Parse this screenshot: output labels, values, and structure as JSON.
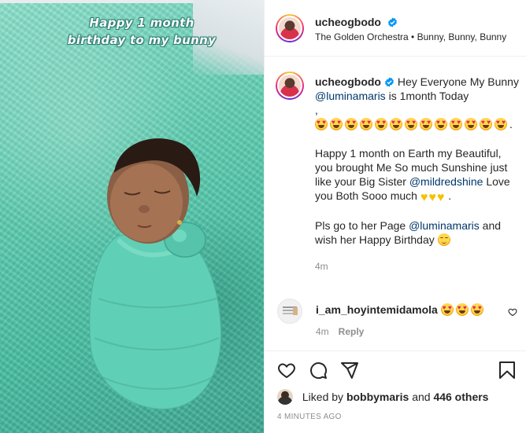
{
  "media": {
    "overlay_line1": "Happy 1 month",
    "overlay_line2": "birthday to my bunny"
  },
  "header": {
    "username": "ucheogbodo",
    "music": "The Golden Orchestra • Bunny, Bunny, Bunny"
  },
  "caption": {
    "username": "ucheogbodo",
    "line1_text": "Hey Everyone My Bunny",
    "line1_mention": "@luminamaris",
    "line1_after": "is 1month Today",
    "line1_comma": ",",
    "heart_eyes_count": 13,
    "para2_text": "Happy 1 month on Earth my Beautiful, you brought Me So much Sunshine just like your Big Sister",
    "para2_mention": "@mildredshine",
    "para2_after": "Love you Both Sooo much",
    "para3_text": "Pls go to her Page",
    "para3_mention": "@luminamaris",
    "para3_after": "and wish her Happy Birthday",
    "time": "4m"
  },
  "comment": {
    "username": "i_am_hoyintemidamola",
    "time": "4m",
    "reply_label": "Reply"
  },
  "actions": {
    "liked_by_prefix": "Liked by",
    "liked_by_user": "bobbymaris",
    "and_label": "and",
    "others_label": "446 others",
    "time_ago": "4 MINUTES AGO"
  },
  "colors": {
    "verified": "#0095f6",
    "mention": "#00376b",
    "muted": "#8e8e8e",
    "media_teal": "#5fcfb3"
  }
}
